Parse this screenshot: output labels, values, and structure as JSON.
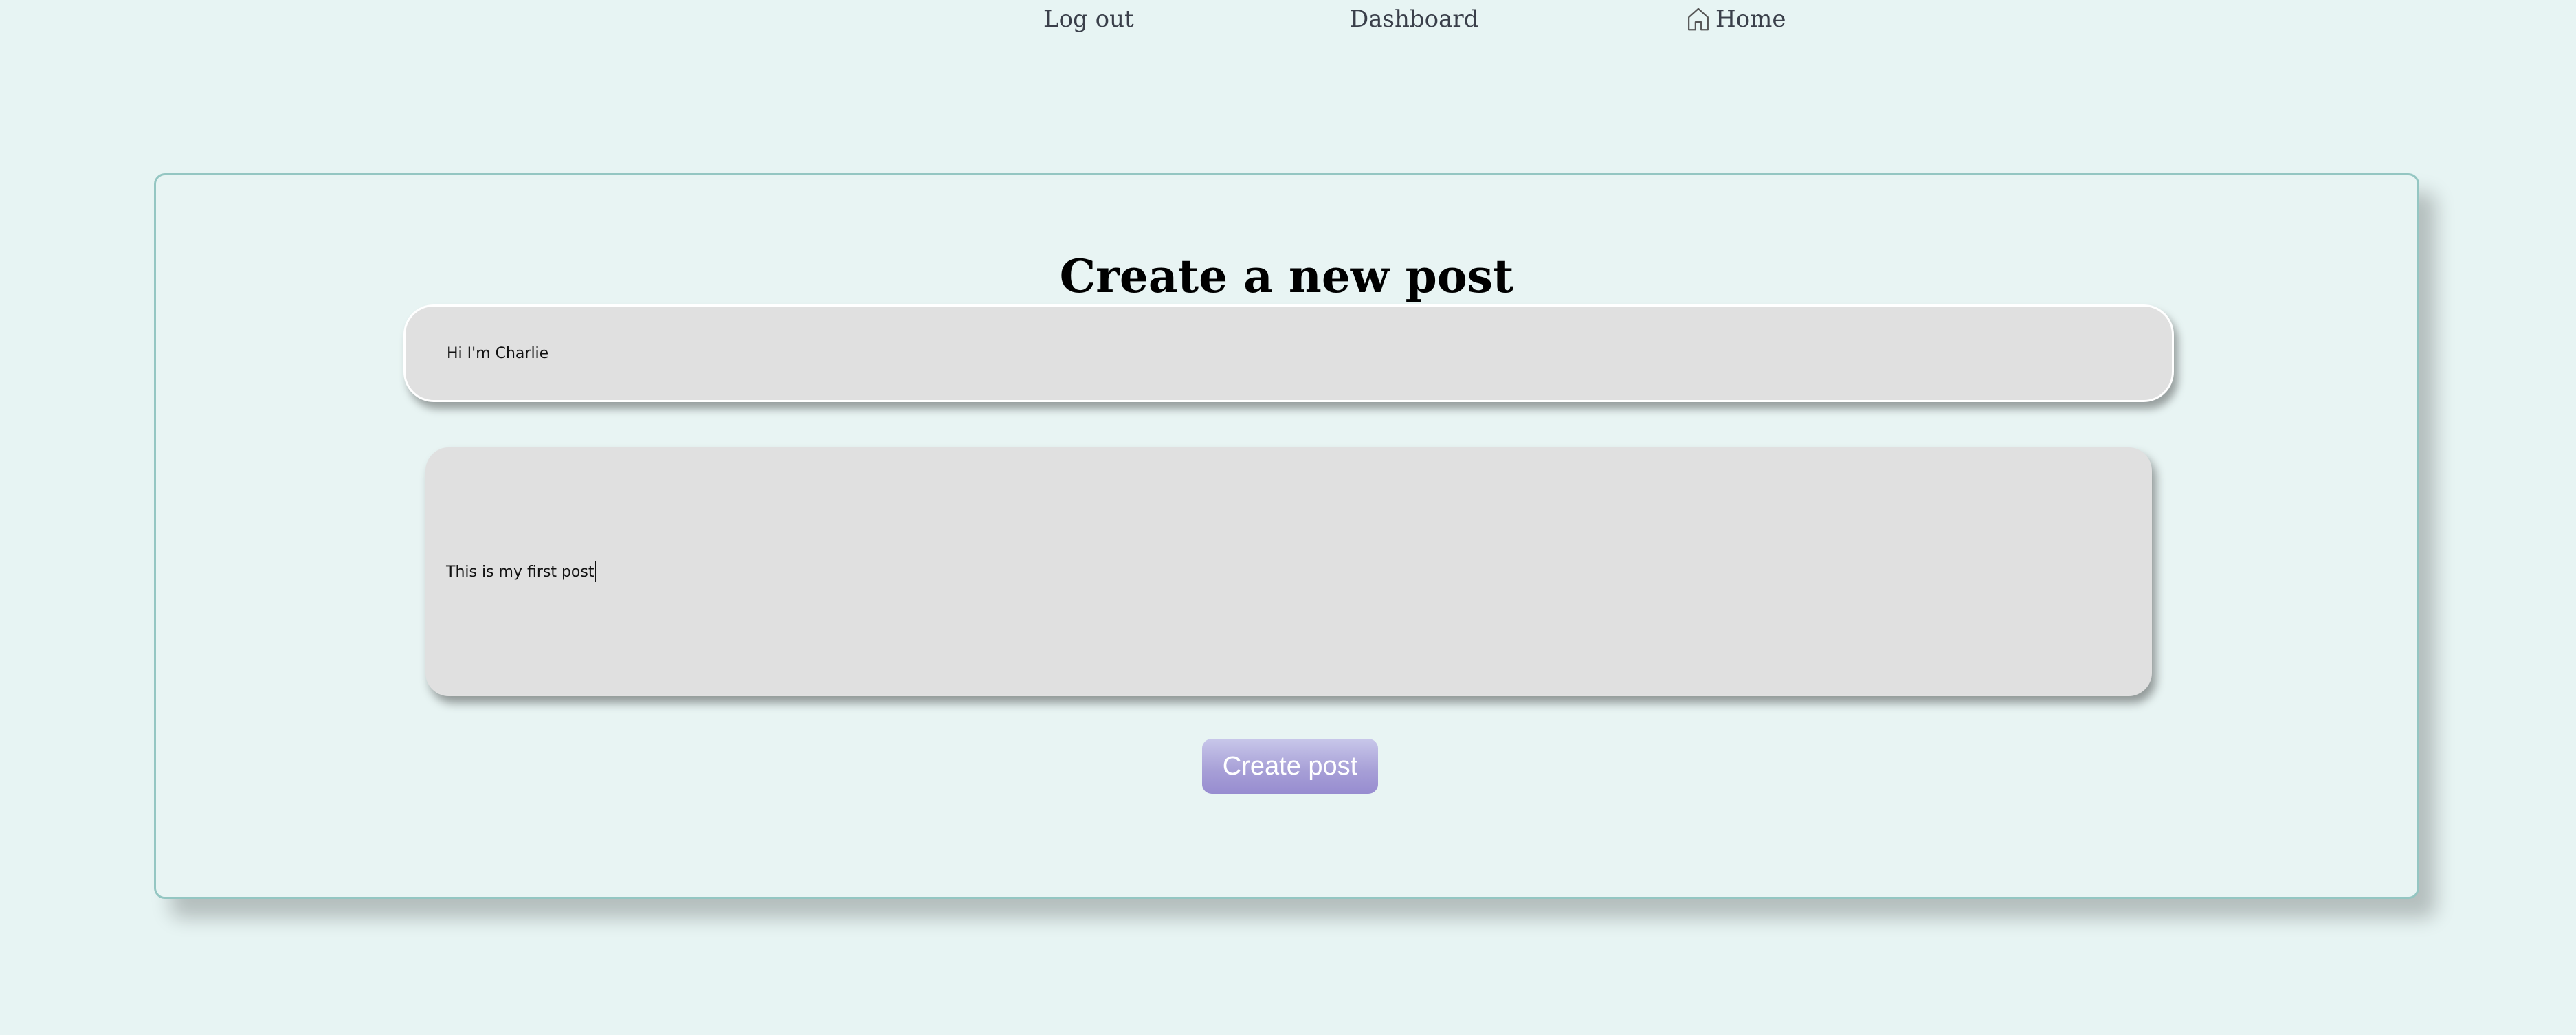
{
  "nav": {
    "logout_label": "Log out",
    "dashboard_label": "Dashboard",
    "home_label": "Home",
    "home_icon": "home-icon"
  },
  "form": {
    "heading": "Create a new post",
    "title_value": "Hi I'm Charlie",
    "body_value": "This is my first post",
    "submit_label": "Create post"
  },
  "colors": {
    "background": "#e7f4f3",
    "card_border": "#94c6c2",
    "input_bg": "#e0e0e0",
    "button_gradient_top": "#c8c7ea",
    "button_gradient_bottom": "#978cd0"
  }
}
